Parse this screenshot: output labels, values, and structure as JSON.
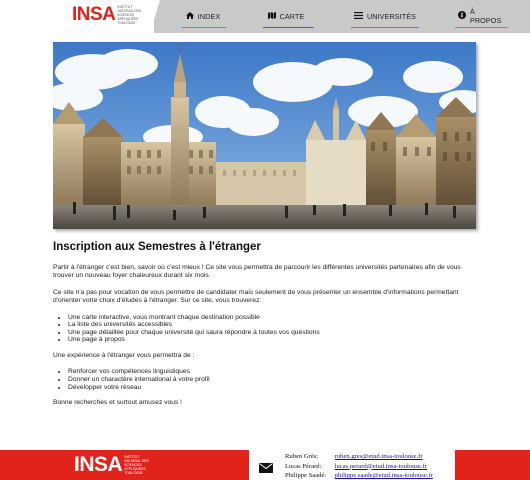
{
  "brand": {
    "logo": "INSA",
    "tagline": "Institut National des Sciences Appliquées Toulouse",
    "colors": {
      "red": "#e2231a",
      "nav_bg": "#c9c9c9"
    }
  },
  "nav": {
    "items": [
      {
        "label": "INDEX",
        "icon": "home-icon"
      },
      {
        "label": "CARTE",
        "icon": "map-icon"
      },
      {
        "label": "UNIVERSITÉS",
        "icon": "list-icon"
      },
      {
        "label": "À PROPOS",
        "icon": "info-icon"
      }
    ]
  },
  "hero": {
    "alt": "Grand-Place"
  },
  "main": {
    "title": "Inscription aux Semestres à l'étranger",
    "intro": "Partir à l'étranger c'est bien, savoir où c'est mieux ! Ce site vous permettra de parcourir les différentes universités partenaires afin de vous trouver un nouveau foyer chaleureux durant six mois.",
    "vocation": "Ce site n'a pas pour vocation de vous permettre de candidater mais seulement de vous présenter un ensemble d'informations permettant d'orienter votre choix d'études à l'étranger. Sur ce site, vous trouverez:",
    "features": [
      "Une carte interactive, vous montrant chaque destination possible",
      "La liste des universités accessibles",
      "Une page détaillée pour chaque université qui saura répondre à toutes vos questions",
      "Une page à propos"
    ],
    "experience_intro": "Une expérience à l'étranger vous permettra de :",
    "benefits": [
      "Renforcer vos compétences linguistiques",
      "Donner un charactère international à votre profil",
      "Développer votre réseau"
    ],
    "closing": "Bonne recherches et surtout amusez vous !"
  },
  "footer": {
    "logo": "INSA",
    "tagline": "Institut National des Sciences Appliquées Toulouse",
    "contacts": [
      {
        "name": "Ruben Grès:",
        "email": "ruben.gres@etud.insa-toulouse.fr"
      },
      {
        "name": "Lucas Pérard:",
        "email": "lucas.perard@etud.insa-toulouse.fr"
      },
      {
        "name": "Philippe Saadé:",
        "email": "philippe.saade@etud.insa-toulouse.fr"
      }
    ],
    "mail_icon": "envelope-icon"
  }
}
